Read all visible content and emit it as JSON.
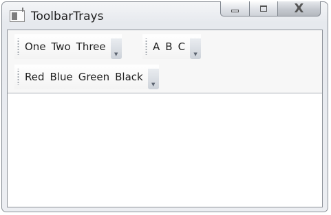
{
  "window": {
    "title": "ToolbarTrays",
    "buttons": {
      "minimize": "",
      "maximize": "",
      "close": "X"
    }
  },
  "toolbars": [
    {
      "items": [
        "One",
        "Two",
        "Three"
      ]
    },
    {
      "items": [
        "A",
        "B",
        "C"
      ]
    },
    {
      "items": [
        "Red",
        "Blue",
        "Green",
        "Black"
      ]
    }
  ],
  "icons": {
    "app": "window-icon",
    "minimize": "minimize-icon",
    "maximize": "maximize-icon",
    "close": "close-icon",
    "grip": "grip-icon",
    "overflow": "chevron-down-icon"
  },
  "colors": {
    "frame": "#eceef2",
    "tray": "#f7f7f7",
    "border": "#8a8f96"
  }
}
